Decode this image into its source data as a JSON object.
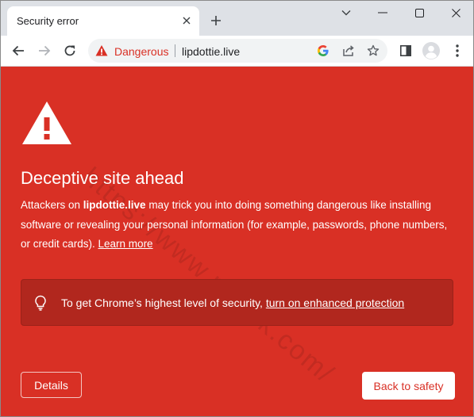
{
  "tab": {
    "title": "Security error",
    "close_icon": "close-icon",
    "new_tab_icon": "plus-icon"
  },
  "window_controls": {
    "dropdown_icon": "chevron-down-icon",
    "minimize_icon": "minimize-icon",
    "maximize_icon": "maximize-icon",
    "close_icon": "close-icon"
  },
  "toolbar": {
    "back_icon": "arrow-left-icon",
    "forward_icon": "arrow-right-icon",
    "reload_icon": "reload-icon",
    "omnibox": {
      "security_icon": "warning-triangle-icon",
      "security_label": "Dangerous",
      "url": "lipdottie.live",
      "google_icon": "google-icon",
      "share_icon": "share-icon",
      "bookmark_icon": "star-icon"
    },
    "side_panel_icon": "side-panel-icon",
    "profile_icon": "avatar-icon",
    "menu_icon": "kebab-menu-icon"
  },
  "page": {
    "warning_icon": "warning-triangle-icon",
    "heading": "Deceptive site ahead",
    "body_prefix": "Attackers on ",
    "body_site": "lipdottie.live",
    "body_suffix": " may trick you into doing something dangerous like installing software or revealing your personal information (for example, passwords, phone numbers, or credit cards). ",
    "learn_more": "Learn more",
    "promo": {
      "icon": "lightbulb-icon",
      "text": "To get Chrome’s highest level of security, ",
      "link": "turn on enhanced protection"
    },
    "details_button": "Details",
    "back_to_safety_button": "Back to safety",
    "watermark": "https://www.pcrisk.com/"
  },
  "colors": {
    "danger_red": "#d93025",
    "promo_red": "#b1271e"
  }
}
